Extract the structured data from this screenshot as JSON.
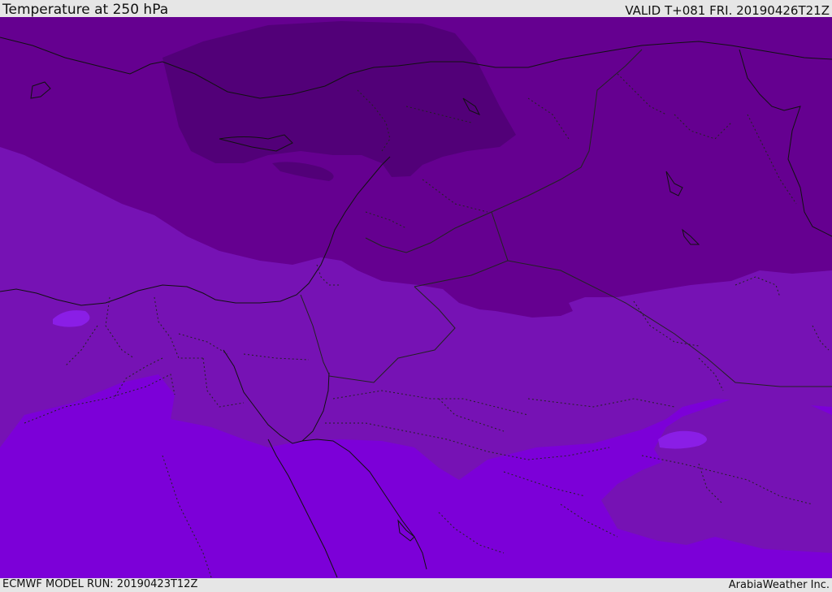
{
  "header": {
    "title": "Temperature at 250 hPa",
    "valid": "VALID T+081 FRI. 20190426T21Z"
  },
  "footer": {
    "model_run": "ECMWF MODEL RUN: 20190423T12Z",
    "credit": "ArabiaWeather Inc."
  },
  "map": {
    "fill_colors": {
      "coldest": "#520078",
      "cold": "#650090",
      "mid": "#7612b4",
      "warm": "#7c00d8",
      "warm_patch": "#8a1ee6"
    },
    "line_colors": {
      "coastline": "#111111",
      "border": "#222222"
    }
  }
}
